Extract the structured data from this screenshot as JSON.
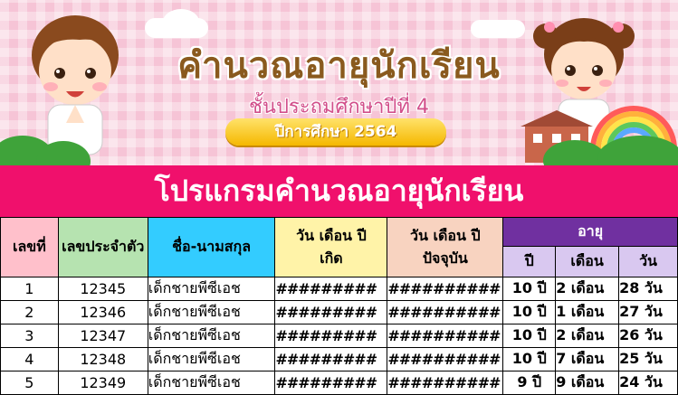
{
  "banner": {
    "title": "คำนวณอายุนักเรียน",
    "subtitle": "ชั้นประถมศึกษาปีที่ 4",
    "year_label": "ปีการศึกษา 2564"
  },
  "program_title": "โปรแกรมคำนวณอายุนักเรียน",
  "table": {
    "headers": {
      "no": "เลขที่",
      "student_id": "เลขประจำตัว",
      "name": "ชื่อ-นามสกุล",
      "dob_line1": "วัน เดือน ปี",
      "dob_line2": "เกิด",
      "now_line1": "วัน เดือน ปี",
      "now_line2": "ปัจจุบัน",
      "age": "อายุ",
      "age_year": "ปี",
      "age_month": "เดือน",
      "age_day": "วัน"
    },
    "rows": [
      {
        "no": "1",
        "id": "12345",
        "name": "เด็กชายพีซีเอช",
        "dob": "#########",
        "now": "##########",
        "y": "10 ปี",
        "m": "2 เดือน",
        "d": "28 วัน"
      },
      {
        "no": "2",
        "id": "12346",
        "name": "เด็กชายพีซีเอช",
        "dob": "#########",
        "now": "##########",
        "y": "10 ปี",
        "m": "1 เดือน",
        "d": "27 วัน"
      },
      {
        "no": "3",
        "id": "12347",
        "name": "เด็กชายพีซีเอช",
        "dob": "#########",
        "now": "##########",
        "y": "10 ปี",
        "m": "2 เดือน",
        "d": "26 วัน"
      },
      {
        "no": "4",
        "id": "12348",
        "name": "เด็กชายพีซีเอช",
        "dob": "#########",
        "now": "##########",
        "y": "10 ปี",
        "m": "7 เดือน",
        "d": "25 วัน"
      },
      {
        "no": "5",
        "id": "12349",
        "name": "เด็กชายพีซีเอช",
        "dob": "#########",
        "now": "##########",
        "y": "9 ปี",
        "m": "9 เดือน",
        "d": "24 วัน"
      }
    ]
  },
  "colors": {
    "banner_bg": "#f6c4d6",
    "program_bar": "#f0106c",
    "title_text": "#8a5a1e",
    "subtitle_text": "#d24f8b",
    "year_pill": "#f5b800",
    "header_no": "#ffc0cb",
    "header_id": "#b6e3b0",
    "header_name": "#33ccff",
    "header_dob": "#fff3a8",
    "header_now": "#f8d3c0",
    "header_age": "#7030a0"
  }
}
